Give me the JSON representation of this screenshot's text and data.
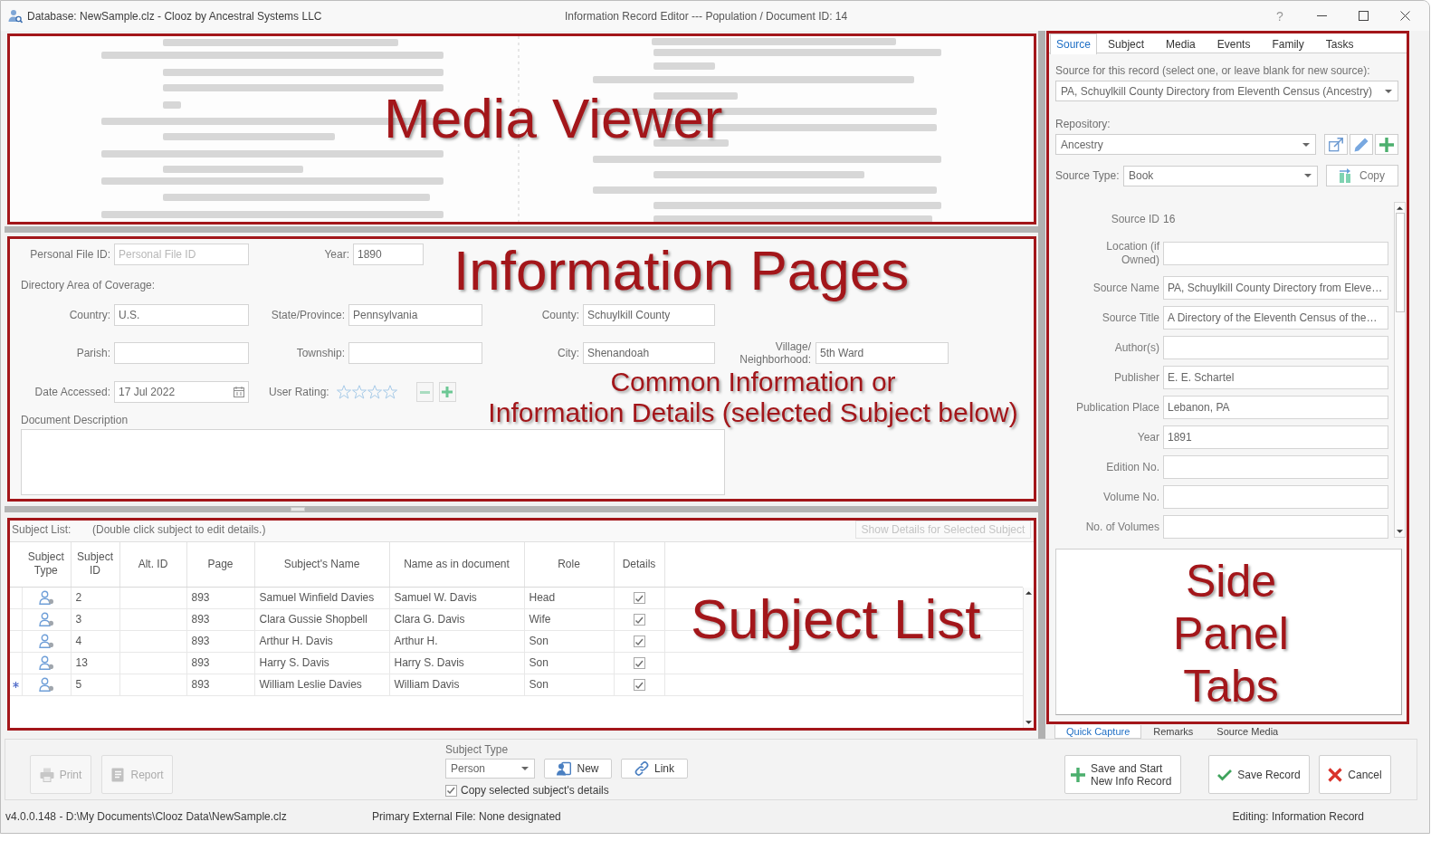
{
  "window": {
    "title": "Database: NewSample.clz - Clooz by Ancestral Systems LLC",
    "caption": "Information Record Editor --- Population / Document ID: 14",
    "help": "?"
  },
  "media_viewer": {
    "annotation": "Media Viewer"
  },
  "information_pages": {
    "annotation": "Information Pages",
    "note": [
      "Common Information or",
      "Information Details (selected Subject below)"
    ],
    "personal_file_id": {
      "label": "Personal File ID:",
      "placeholder": "Personal File ID"
    },
    "year": {
      "label": "Year:",
      "value": "1890"
    },
    "coverage_heading": "Directory Area of Coverage:",
    "coverage_rows": [
      [
        {
          "label": "Country:",
          "value": "U.S."
        },
        {
          "label": "State/Province:",
          "value": "Pennsylvania"
        },
        {
          "label": "County:",
          "value": "Schuylkill County"
        }
      ],
      [
        {
          "label": "Parish:"
        },
        {
          "label": "Township:"
        },
        {
          "label": "City:",
          "value": "Shenandoah"
        },
        {
          "label": "Village/ Neighborhood:",
          "value": "5th Ward"
        }
      ]
    ],
    "date_accessed": {
      "label": "Date Accessed:",
      "value": "17 Jul 2022"
    },
    "user_rating": {
      "label": "User Rating:",
      "stars": 0
    },
    "description": {
      "label": "Document Description"
    }
  },
  "subject_list": {
    "annotation": "Subject List",
    "label": "Subject List:",
    "hint": "(Double click subject to edit details.)",
    "details_button": {
      "label": "Show Details for Selected Subject",
      "disabled": true
    },
    "columns": [
      "Subject Type",
      "Subject ID",
      "Alt. ID",
      "Page",
      "Subject's Name",
      "Name as in document",
      "Role",
      "Details"
    ],
    "rows": [
      {
        "subject_id": "2",
        "page": "893",
        "name": "Samuel Winfield Davies",
        "name_in_document": "Samuel W. Davis",
        "role": "Head",
        "details": true,
        "current": false
      },
      {
        "subject_id": "3",
        "page": "893",
        "name": "Clara Gussie Shopbell",
        "name_in_document": "Clara G. Davis",
        "role": "Wife",
        "details": true,
        "current": false
      },
      {
        "subject_id": "4",
        "page": "893",
        "name": "Arthur H. Davis",
        "name_in_document": "Arthur H.",
        "role": "Son",
        "details": true,
        "current": false
      },
      {
        "subject_id": "13",
        "page": "893",
        "name": "Harry S. Davis",
        "name_in_document": "Harry S. Davis",
        "role": "Son",
        "details": true,
        "current": false
      },
      {
        "subject_id": "5",
        "page": "893",
        "name": "William Leslie Davies",
        "name_in_document": "William Davis",
        "role": "Son",
        "details": true,
        "current": true
      }
    ]
  },
  "side_panel": {
    "annotation": "Side Panel Tabs",
    "tabs": [
      {
        "label": "Source",
        "selected": true
      },
      {
        "label": "Subject",
        "selected": false
      },
      {
        "label": "Media",
        "selected": false
      },
      {
        "label": "Events",
        "selected": false
      },
      {
        "label": "Family",
        "selected": false
      },
      {
        "label": "Tasks",
        "selected": false
      }
    ],
    "source_label": "Source for this record (select one, or leave blank for new source):",
    "source": "PA, Schuylkill County Directory from Eleventh Census (Ancestry)",
    "repository_label": "Repository:",
    "repository": "Ancestry",
    "source_type_label": "Source Type:",
    "source_type": "Book",
    "copy_button": "Copy",
    "details": [
      {
        "kind": "static",
        "label": "Source ID",
        "value": "16"
      },
      {
        "kind": "field",
        "label": "Location (if Owned)"
      },
      {
        "kind": "field",
        "label": "Source Name",
        "value": "PA, Schuylkill County Directory from Eleve…"
      },
      {
        "kind": "field",
        "label": "Source Title",
        "value": "A Directory of the Eleventh Census of the…"
      },
      {
        "kind": "field",
        "label": "Author(s)"
      },
      {
        "kind": "field",
        "label": "Publisher",
        "value": "E. E. Schartel"
      },
      {
        "kind": "field",
        "label": "Publication Place",
        "value": "Lebanon, PA"
      },
      {
        "kind": "field",
        "label": "Year",
        "value": "1891"
      },
      {
        "kind": "field",
        "label": "Edition No."
      },
      {
        "kind": "field",
        "label": "Volume No."
      },
      {
        "kind": "field",
        "label": "No. of Volumes"
      }
    ],
    "bottom_tabs": [
      {
        "label": "Quick Capture",
        "selected": true
      },
      {
        "label": "Remarks",
        "selected": false
      },
      {
        "label": "Source Media",
        "selected": false
      }
    ]
  },
  "toolbar": {
    "buttons": [
      {
        "kind": "print",
        "label": "Print",
        "disabled": true
      },
      {
        "kind": "report",
        "label": "Report",
        "disabled": true
      }
    ],
    "subject_type": {
      "label": "Subject Type",
      "value": "Person"
    },
    "subject_buttons": [
      {
        "kind": "new",
        "label": "New"
      },
      {
        "kind": "link",
        "label": "Link"
      }
    ],
    "copy_details": {
      "label": "Copy selected subject's details",
      "checked": true
    },
    "actions": [
      {
        "kind": "save_new",
        "label": "Save and Start New Info Record"
      },
      {
        "kind": "save",
        "label": "Save Record"
      },
      {
        "kind": "cancel",
        "label": "Cancel"
      }
    ]
  },
  "status_bar": {
    "file": "v4.0.0.148 - D:\\My Documents\\Clooz Data\\NewSample.clz",
    "external_file": "Primary External File: None designated",
    "mode": "Editing: Information Record"
  }
}
